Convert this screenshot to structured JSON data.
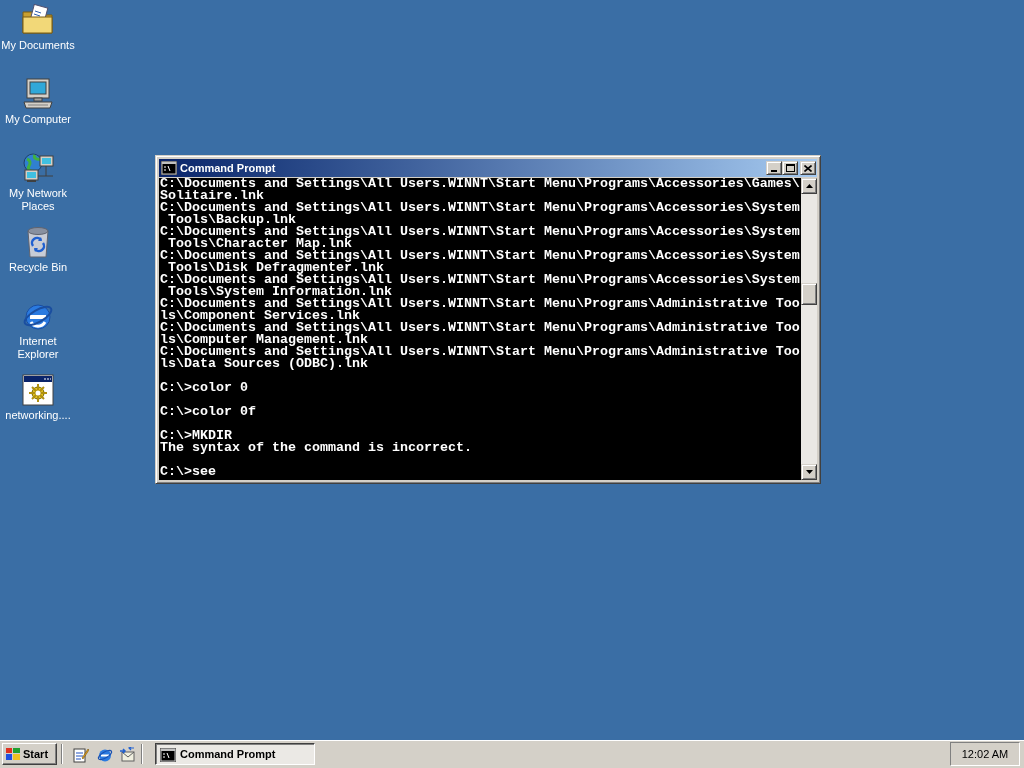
{
  "desktop": {
    "icons": [
      {
        "label": "My Documents",
        "kind": "documents"
      },
      {
        "label": "My Computer",
        "kind": "computer"
      },
      {
        "label": "My Network Places",
        "kind": "network"
      },
      {
        "label": "Recycle Bin",
        "kind": "recycle"
      },
      {
        "label": "Internet Explorer",
        "kind": "browser"
      },
      {
        "label": "networking....",
        "kind": "program"
      }
    ]
  },
  "window": {
    "title": "Command Prompt"
  },
  "console": {
    "blocks": [
      [
        "C:\\Documents and Settings\\All Users.WINNT\\Start Menu\\Programs\\Accessories\\Games\\",
        "Solitaire.lnk",
        "C:\\Documents and Settings\\All Users.WINNT\\Start Menu\\Programs\\Accessories\\System",
        " Tools\\Backup.lnk",
        "C:\\Documents and Settings\\All Users.WINNT\\Start Menu\\Programs\\Accessories\\System",
        " Tools\\Character Map.lnk",
        "C:\\Documents and Settings\\All Users.WINNT\\Start Menu\\Programs\\Accessories\\System",
        " Tools\\Disk Defragmenter.lnk",
        "C:\\Documents and Settings\\All Users.WINNT\\Start Menu\\Programs\\Accessories\\System",
        " Tools\\System Information.lnk",
        "C:\\Documents and Settings\\All Users.WINNT\\Start Menu\\Programs\\Administrative Too",
        "ls\\Component Services.lnk",
        "C:\\Documents and Settings\\All Users.WINNT\\Start Menu\\Programs\\Administrative Too",
        "ls\\Computer Management.lnk",
        "C:\\Documents and Settings\\All Users.WINNT\\Start Menu\\Programs\\Administrative Too",
        "ls\\Data Sources (ODBC).lnk"
      ],
      [
        "C:\\>color 0"
      ],
      [
        "C:\\>color 0f"
      ],
      [
        "C:\\>MKDIR",
        "The syntax of the command is incorrect."
      ],
      [
        "C:\\>see"
      ]
    ]
  },
  "taskbar": {
    "start_button": "Start",
    "tasks": [
      {
        "label": "Command Prompt",
        "selected": true
      }
    ],
    "clock": "12:02 AM"
  }
}
